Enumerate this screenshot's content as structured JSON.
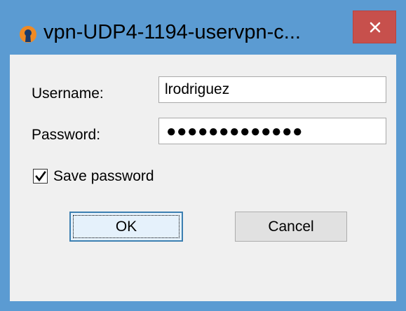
{
  "window": {
    "title": "vpn-UDP4-1194-uservpn-c...",
    "close_symbol": "✕",
    "app_icon": "openvpn-icon",
    "close_icon": "close-icon"
  },
  "form": {
    "username_label": "Username:",
    "username_value": "lrodriguez",
    "password_label": "Password:",
    "password_display": "●●●●●●●●●●●●●",
    "save_password_label": "Save password",
    "save_password_checked": true
  },
  "buttons": {
    "ok_label": "OK",
    "cancel_label": "Cancel"
  },
  "colors": {
    "titlebar": "#5b9bd2",
    "close_button": "#c7504c",
    "dialog_bg": "#f0f0f0",
    "icon_orange": "#f08a24",
    "icon_navy": "#1a3a6b"
  }
}
